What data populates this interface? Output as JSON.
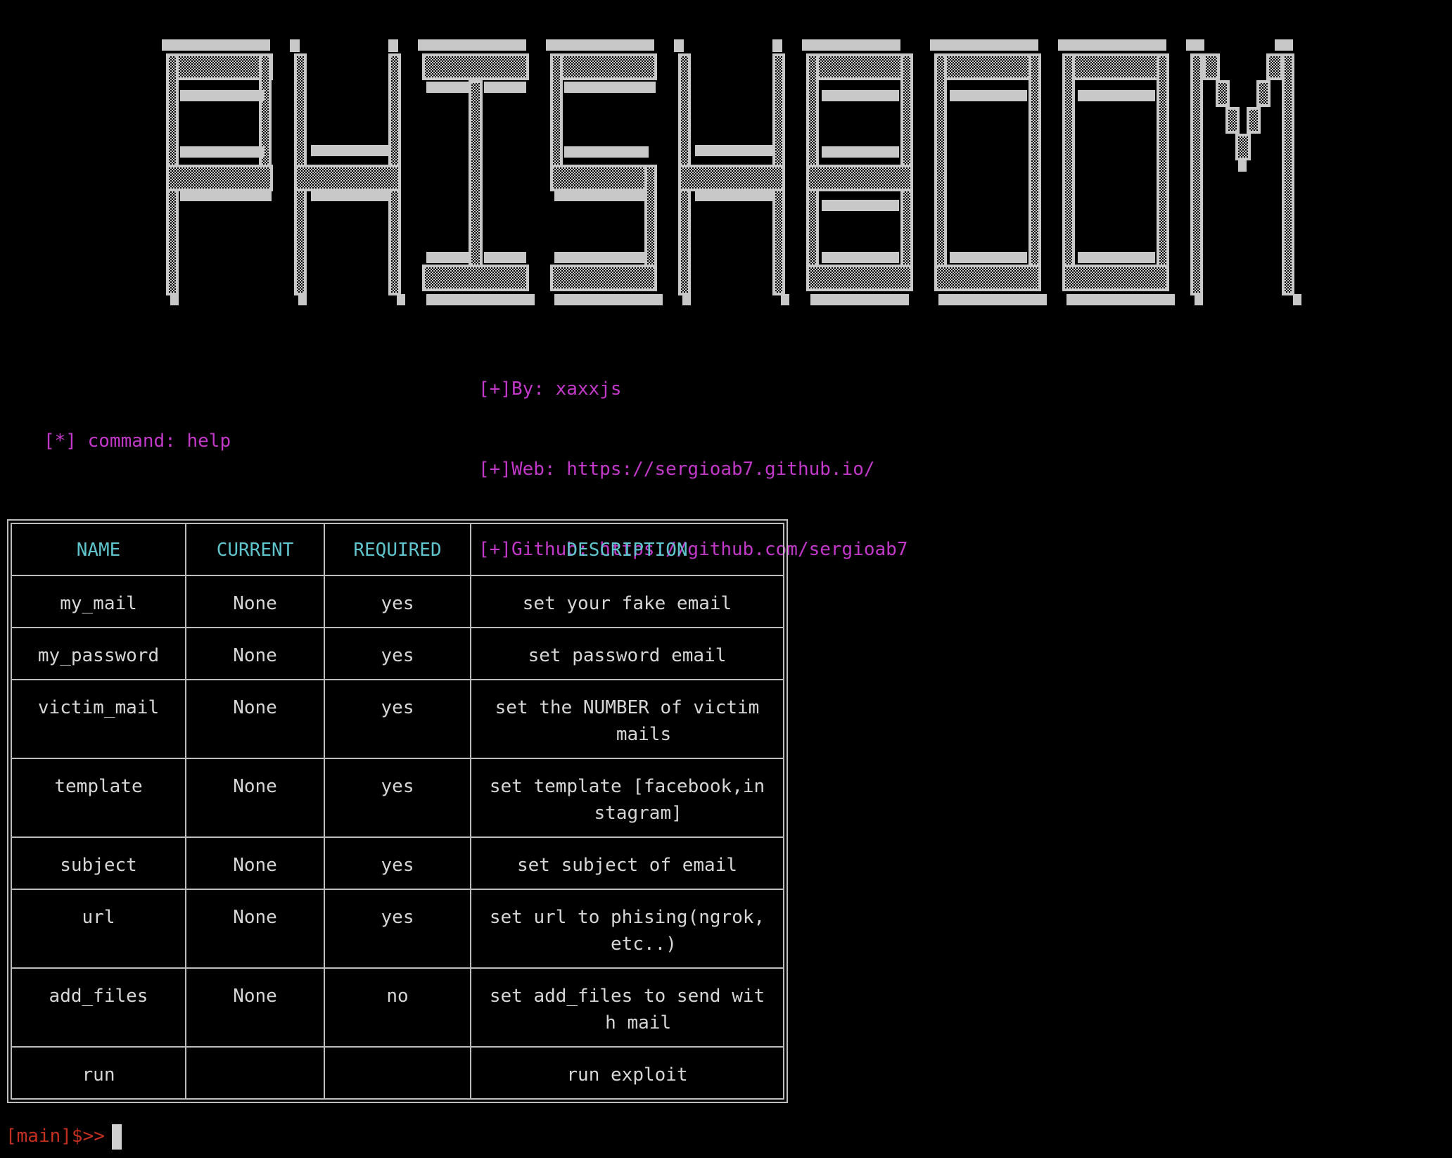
{
  "banner": {
    "text": "PHISHBOOM"
  },
  "info": {
    "by": "[+]By: xaxxjs",
    "web": "[+]Web: https://sergioab7.github.io/",
    "github": "[+]Github: https://github.com/sergioab7"
  },
  "command_line": "[*] command: help",
  "table": {
    "headers": [
      "NAME",
      "CURRENT",
      "REQUIRED",
      "DESCRIPTION"
    ],
    "rows": [
      {
        "name": "my_mail",
        "current": "None",
        "required": "yes",
        "description": "set your fake email"
      },
      {
        "name": "my_password",
        "current": "None",
        "required": "yes",
        "description": "set password email"
      },
      {
        "name": "victim_mail",
        "current": "None",
        "required": "yes",
        "description": "set the NUMBER of victim\n   mails"
      },
      {
        "name": "template",
        "current": "None",
        "required": "yes",
        "description": "set template [facebook,in\n  stagram]"
      },
      {
        "name": "subject",
        "current": "None",
        "required": "yes",
        "description": "set subject of email"
      },
      {
        "name": "url",
        "current": "None",
        "required": "yes",
        "description": "set url to phising(ngrok,\n   etc..)"
      },
      {
        "name": "add_files",
        "current": "None",
        "required": "no",
        "description": "set add_files to send wit\n  h mail"
      },
      {
        "name": "run",
        "current": "",
        "required": "",
        "description": "run exploit"
      }
    ]
  },
  "prompt": "[main]$>>",
  "colors": {
    "background": "#000000",
    "banner": "#c8c8c8",
    "info": "#c238c8",
    "header": "#5fc4cc",
    "prompt": "#c43020"
  }
}
